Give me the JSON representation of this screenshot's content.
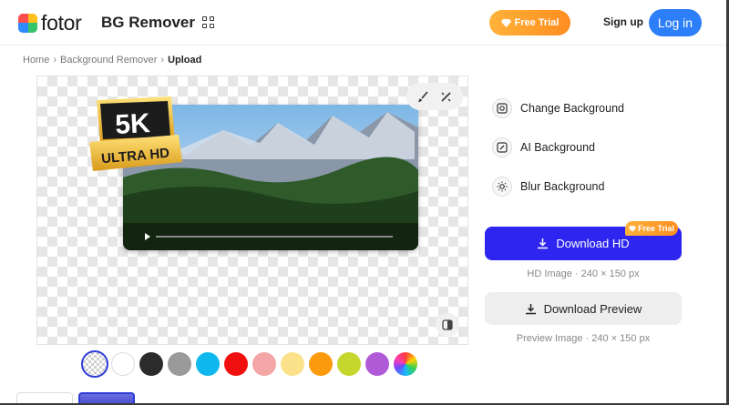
{
  "header": {
    "logo_text": "fotor",
    "product_name": "BG Remover",
    "free_trial_label": "Free Trial",
    "signup_label": "Sign up",
    "login_label": "Log in",
    "accent_color": "#2d7ff9",
    "trial_color": "#ff9a2a"
  },
  "breadcrumb": [
    "Home",
    "Background Remover",
    "Upload"
  ],
  "canvas": {
    "badge_top": "5K",
    "badge_bottom": "ULTRA HD"
  },
  "swatches": [
    {
      "name": "transparent",
      "color": "transparent",
      "selected": true
    },
    {
      "name": "white",
      "color": "#ffffff"
    },
    {
      "name": "black",
      "color": "#2b2b2b"
    },
    {
      "name": "gray",
      "color": "#9a9a9a"
    },
    {
      "name": "cyan",
      "color": "#0fb8ee"
    },
    {
      "name": "red",
      "color": "#f01010"
    },
    {
      "name": "pink",
      "color": "#f4a5a5"
    },
    {
      "name": "light-yellow",
      "color": "#fbe28a"
    },
    {
      "name": "orange",
      "color": "#fb9a0c"
    },
    {
      "name": "lime",
      "color": "#c5d62c"
    },
    {
      "name": "purple",
      "color": "#b05ad8"
    },
    {
      "name": "custom",
      "color": "rainbow"
    }
  ],
  "options": [
    {
      "label": "Change Background",
      "icon": "change-background-icon"
    },
    {
      "label": "AI Background",
      "icon": "ai-background-icon"
    },
    {
      "label": "Blur Background",
      "icon": "blur-background-icon"
    }
  ],
  "download": {
    "hd_label": "Download HD",
    "hd_badge": "Free Trial",
    "hd_meta": "HD Image · 240 × 150 px",
    "preview_label": "Download Preview",
    "preview_meta": "Preview Image · 240 × 150 px",
    "hd_color": "#2e26f0"
  }
}
